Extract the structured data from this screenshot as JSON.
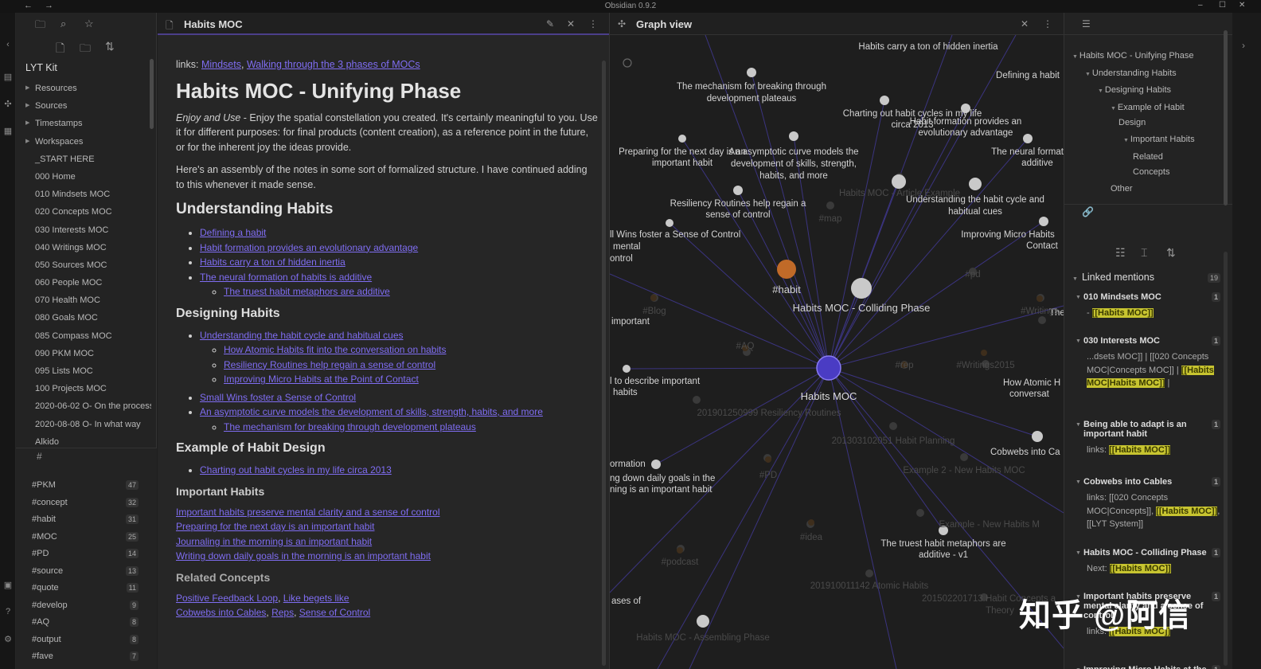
{
  "window": {
    "title": "Obsidian 0.9.2"
  },
  "left_sidebar": {
    "vault_name": "LYT Kit",
    "tree": [
      {
        "label": "Resources",
        "folder": true
      },
      {
        "label": "Sources",
        "folder": true
      },
      {
        "label": "Timestamps",
        "folder": true
      },
      {
        "label": "Workspaces",
        "folder": true
      },
      {
        "label": "_START HERE",
        "folder": false
      },
      {
        "label": "000 Home",
        "folder": false
      },
      {
        "label": "010 Mindsets MOC",
        "folder": false
      },
      {
        "label": "020 Concepts MOC",
        "folder": false
      },
      {
        "label": "030 Interests MOC",
        "folder": false
      },
      {
        "label": "040 Writings MOC",
        "folder": false
      },
      {
        "label": "050 Sources MOC",
        "folder": false
      },
      {
        "label": "060 People MOC",
        "folder": false
      },
      {
        "label": "070 Health MOC",
        "folder": false
      },
      {
        "label": "080 Goals MOC",
        "folder": false
      },
      {
        "label": "085 Compass MOC",
        "folder": false
      },
      {
        "label": "090 PKM MOC",
        "folder": false
      },
      {
        "label": "095 Lists MOC",
        "folder": false
      },
      {
        "label": "100 Projects MOC",
        "folder": false
      },
      {
        "label": "2020-06-02 O- On the process",
        "folder": false
      },
      {
        "label": "2020-08-08 O- In what way",
        "folder": false
      },
      {
        "label": "Alkido",
        "folder": false
      }
    ],
    "tag_pane_header": "#",
    "tags": [
      {
        "name": "#PKM",
        "count": "47"
      },
      {
        "name": "#concept",
        "count": "32"
      },
      {
        "name": "#habit",
        "count": "31"
      },
      {
        "name": "#MOC",
        "count": "25"
      },
      {
        "name": "#PD",
        "count": "14"
      },
      {
        "name": "#source",
        "count": "13"
      },
      {
        "name": "#quote",
        "count": "11"
      },
      {
        "name": "#develop",
        "count": "9"
      },
      {
        "name": "#AQ",
        "count": "8"
      },
      {
        "name": "#output",
        "count": "8"
      },
      {
        "name": "#fave",
        "count": "7"
      }
    ]
  },
  "editor": {
    "tab_title": "Habits MOC",
    "links_label": "links:",
    "links": [
      "Mindsets",
      "Walking through the 3 phases of MOCs"
    ],
    "links_sep": ",",
    "h1": "Habits MOC - Unifying Phase",
    "intro_em": "Enjoy and Use",
    "intro": " - Enjoy the spatial constellation you created. It's certainly meaningful to you. Use it for different purposes: for final products (content creation), as a reference point in the future, or for the inherent joy the ideas provide.",
    "para2": "Here's an assembly of the notes in some sort of formalized structure. I have continued adding to this whenever it made sense.",
    "sec1": {
      "title": "Understanding Habits",
      "items": [
        "Defining a habit",
        "Habit formation provides an evolutionary advantage",
        "Habits carry a ton of hidden inertia",
        "The neural formation of habits is additive"
      ],
      "sub": [
        "The truest habit metaphors are additive"
      ]
    },
    "sec2": {
      "title": "Designing Habits",
      "item1": "Understanding the habit cycle and habitual cues",
      "sub1": [
        "How Atomic Habits fit into the conversation on habits",
        "Resiliency Routines help regain a sense of control",
        "Improving Micro Habits at the Point of Contact"
      ],
      "item2": "Small Wins foster a Sense of Control",
      "item3": "An asymptotic curve models the development of skills, strength, habits, and more",
      "sub3": [
        "The mechanism for breaking through development plateaus"
      ]
    },
    "sec3": {
      "title": "Example of Habit Design",
      "items": [
        "Charting out habit cycles in my life circa 2013"
      ]
    },
    "sec4": {
      "title": "Important Habits",
      "items": [
        "Important habits preserve mental clarity and a sense of control",
        "Preparing for the next day is an important habit",
        "Journaling in the morning is an important habit",
        "Writing down daily goals in the morning is an important habit"
      ]
    },
    "sec5": {
      "title": "Related Concepts",
      "row1": [
        "Positive Feedback Loop",
        "Like begets like"
      ],
      "row2": [
        "Cobwebs into Cables",
        "Reps",
        "Sense of Control"
      ]
    }
  },
  "graph": {
    "tab_title": "Graph view",
    "center": "Habits MOC",
    "labels": [
      "Habits carry a ton of hidden inertia",
      "The mechanism for breaking through",
      "development plateaus",
      "Defining a habit",
      "Charting out habit cycles in my life",
      "circa 2013",
      "Habit formation provides an",
      "evolutionary advantage",
      "Preparing for the next day is an",
      "important habit",
      "An asymptotic curve models the",
      "development of skills, strength,",
      "habits, and more",
      "The neural formation o",
      "additive",
      "Resiliency Routines help regain a",
      "sense of control",
      "Understanding the habit cycle and",
      "habitual cues",
      "ll Wins foster a Sense of Control",
      "mental",
      "ontrol",
      "Improving Micro Habits",
      "Contact",
      "#habit",
      "Habits MOC - Colliding Phase",
      "important",
      "l to describe important",
      "habits",
      "How Atomic H",
      "conversat",
      "Cobwebs into Ca",
      "ormation",
      "ng down daily goals in the",
      "ning is an important habit",
      "The truest habit metaphors are",
      "additive - v1",
      "ases of",
      "The"
    ],
    "faint_labels": [
      "Habits MOC - Article Example",
      "#map",
      "#pd",
      "#Blog",
      "#Writings",
      "#AQ",
      "#rep",
      "#Writings2015",
      "201901250999 Resiliency Routines",
      "201303102051 Habit Planning",
      "Example 2 - New Habits MOC",
      "#PD",
      "Example - New Habits M",
      "#idea",
      "#podcast",
      "201910011142 Atomic Habits",
      "201502201713 Habit Concepts a",
      "Theory",
      "Habits MOC - Assembling Phase"
    ]
  },
  "right_sidebar": {
    "outline": [
      "Habits MOC - Unifying Phase",
      "Understanding Habits",
      "Designing Habits",
      "Example of Habit",
      "Design",
      "Important Habits",
      "Related",
      "Concepts",
      "Other"
    ],
    "linked_mentions_title": "Linked mentions",
    "linked_mentions_count": "19",
    "mentions": [
      {
        "title": "010 Mindsets MOC",
        "count": "1",
        "pre": "- ",
        "hl": "[[Habits MOC]]"
      },
      {
        "title": "030 Interests MOC",
        "count": "1",
        "text": "...dsets MOC]] | [[020 Concepts MOC|Concepts MOC]] | ",
        "hl": "[[Habits MOC|Habits MOC]]",
        "post": " |"
      },
      {
        "title": "Being able to adapt is an important habit",
        "count": "1",
        "pre": "links: ",
        "hl": "[[Habits MOC]]"
      },
      {
        "title": "Cobwebs into Cables",
        "count": "1",
        "pre": "links: [[020 Concepts MOC|Concepts]], ",
        "hl": "[[Habits MOC]]",
        "post": ", [[LYT System]]"
      },
      {
        "title": "Habits MOC - Colliding Phase",
        "count": "1",
        "pre": "Next: ",
        "hl": "[[Habits MOC]]"
      },
      {
        "title": "Important habits preserve mental clarity and a sense of control",
        "count": "1",
        "pre": "links: ",
        "hl": "[[Habits MOC]]"
      },
      {
        "title": "Improving Micro Habits at the",
        "count": "1"
      }
    ]
  },
  "watermark": "知乎 @阿信"
}
